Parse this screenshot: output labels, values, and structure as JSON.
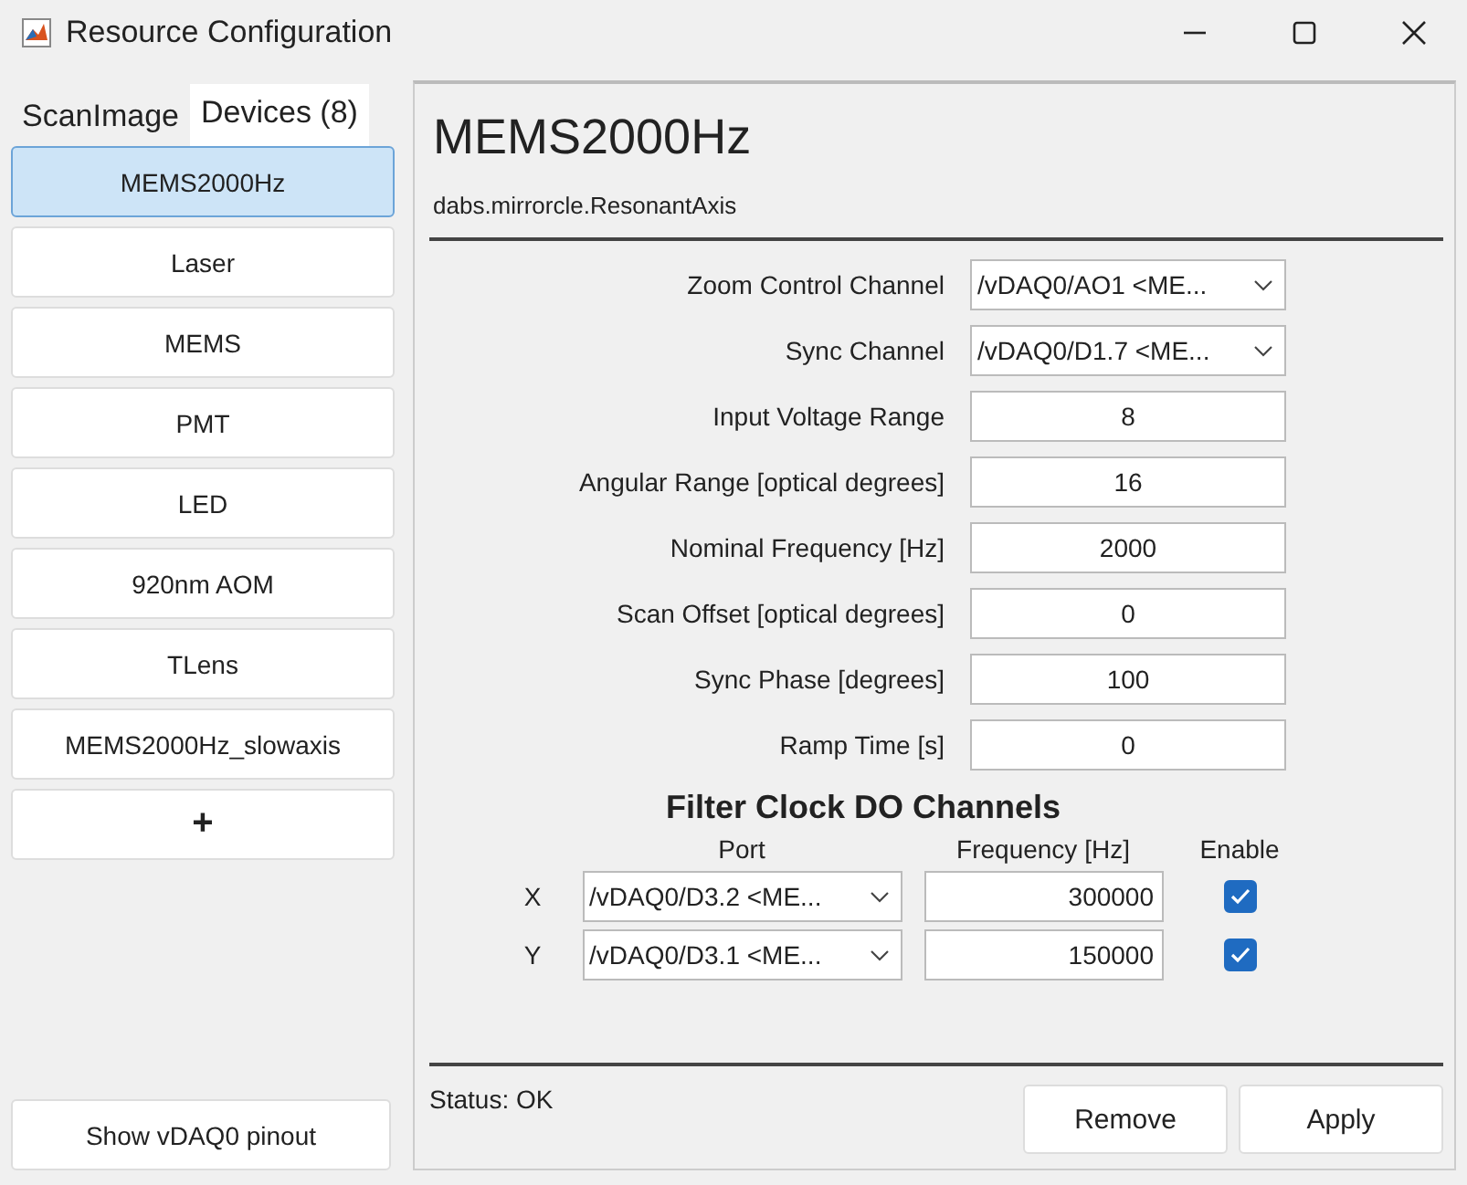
{
  "window": {
    "title": "Resource Configuration"
  },
  "tabs": [
    {
      "label": "ScanImage",
      "selected": false
    },
    {
      "label": "Devices (8)",
      "selected": true
    }
  ],
  "devices": [
    {
      "label": "MEMS2000Hz",
      "selected": true
    },
    {
      "label": "Laser",
      "selected": false
    },
    {
      "label": "MEMS",
      "selected": false
    },
    {
      "label": "PMT",
      "selected": false
    },
    {
      "label": "LED",
      "selected": false
    },
    {
      "label": "920nm AOM",
      "selected": false
    },
    {
      "label": "TLens",
      "selected": false
    },
    {
      "label": "MEMS2000Hz_slowaxis",
      "selected": false
    },
    {
      "label": "+",
      "selected": false
    }
  ],
  "pinout_button": "Show vDAQ0 pinout",
  "device": {
    "name": "MEMS2000Hz",
    "class": "dabs.mirrorcle.ResonantAxis"
  },
  "fields": [
    {
      "label": "Zoom Control Channel",
      "kind": "dropdown",
      "value": "/vDAQ0/AO1 <ME..."
    },
    {
      "label": "Sync Channel",
      "kind": "dropdown",
      "value": "/vDAQ0/D1.7 <ME..."
    },
    {
      "label": "Input Voltage Range",
      "kind": "text",
      "value": "8"
    },
    {
      "label": "Angular Range [optical degrees]",
      "kind": "text",
      "value": "16"
    },
    {
      "label": "Nominal Frequency [Hz]",
      "kind": "text",
      "value": "2000"
    },
    {
      "label": "Scan Offset [optical degrees]",
      "kind": "text",
      "value": "0"
    },
    {
      "label": "Sync Phase [degrees]",
      "kind": "text",
      "value": "100"
    },
    {
      "label": "Ramp Time [s]",
      "kind": "text",
      "value": "0"
    }
  ],
  "filter_clock": {
    "title": "Filter Clock DO Channels",
    "columns": [
      "Port",
      "Frequency [Hz]",
      "Enable"
    ],
    "rows": [
      {
        "axis": "X",
        "port": "/vDAQ0/D3.2 <ME...",
        "frequency": "300000",
        "checked": true
      },
      {
        "axis": "Y",
        "port": "/vDAQ0/D3.1 <ME...",
        "frequency": "150000",
        "checked": true
      }
    ]
  },
  "status": "Status: OK",
  "buttons": [
    "Remove",
    "Apply"
  ]
}
